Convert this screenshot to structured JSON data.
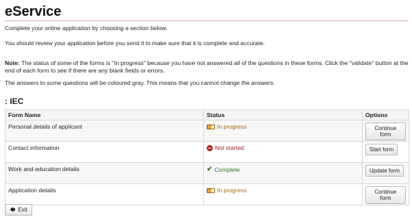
{
  "header": {
    "title": "eService"
  },
  "intro": {
    "line1": "Complete your online application by choosing a section below.",
    "line2": "You should review your application before you send it to make sure that it is complete and accurate."
  },
  "note": {
    "label": "Note:",
    "text": " The status of some of the forms is \"In progress\" because you have not answered all of the questions in these forms. Click the \"validate\" button at the end of each form to see if there are any blank fields or errors.",
    "gray_text": "The answers to some questions will be coloured gray. This means that you cannot change the answers."
  },
  "section": {
    "heading": ": IEC"
  },
  "table": {
    "columns": [
      "Form Name",
      "Status",
      "Options"
    ],
    "rows": [
      {
        "name": "Personal details of applicant",
        "status": "In progress",
        "status_icon": "progress-icon",
        "action": "Continue form"
      },
      {
        "name": "Contact information",
        "status": "Not started",
        "status_icon": "not-started-icon",
        "action": "Start form"
      },
      {
        "name": "Work and education details",
        "status": "Complete",
        "status_icon": "checkmark-icon",
        "action": "Update form"
      },
      {
        "name": "Application details",
        "status": "In progress",
        "status_icon": "progress-icon",
        "action": "Continue form"
      }
    ]
  },
  "footer": {
    "exit_label": "Exit",
    "exit_icon": "arrow-left-icon"
  },
  "colors": {
    "rule": "#d9a3a8",
    "in_progress": "#9a6a10",
    "not_started": "#a01d1d",
    "complete": "#2d7a1e"
  }
}
